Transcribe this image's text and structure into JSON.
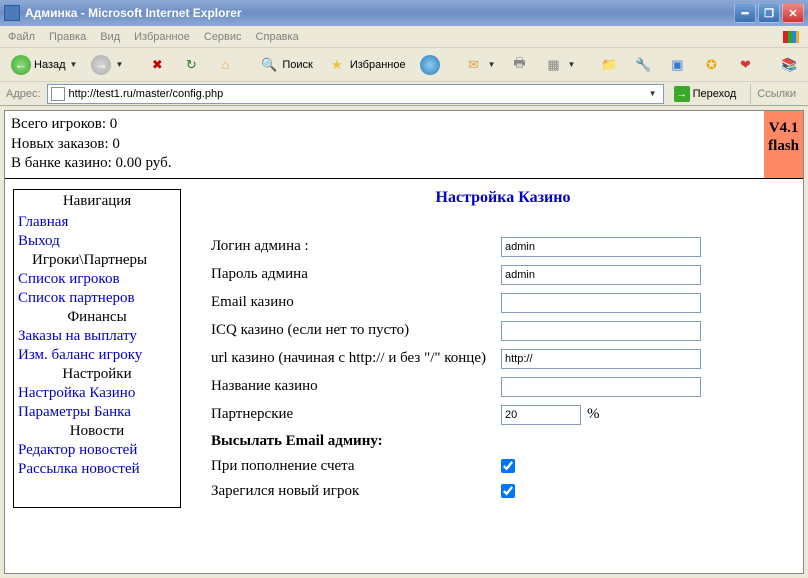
{
  "window": {
    "title": "Админка - Microsoft Internet Explorer"
  },
  "menu": {
    "items": [
      "Файл",
      "Правка",
      "Вид",
      "Избранное",
      "Сервис",
      "Справка"
    ]
  },
  "toolbar": {
    "back_label": "Назад",
    "search_label": "Поиск",
    "favorites_label": "Избранное"
  },
  "addressbar": {
    "label": "Адрес:",
    "url": "http://test1.ru/master/config.php",
    "go_label": "Переход",
    "links_label": "Ссылки"
  },
  "stats": {
    "players": "Всего игроков: 0",
    "new_orders": "Новых заказов: 0",
    "bank": "В банке казино: 0.00 руб.",
    "version_line1": "V4.1",
    "version_line2": "flash"
  },
  "nav": {
    "header": "Навигация",
    "home": "Главная",
    "exit": "Выход",
    "players_partners": "Игроки\\Партнеры",
    "players_list": "Список игроков",
    "partners_list": "Список партнеров",
    "finances": "Финансы",
    "payout_orders": "Заказы на выплату",
    "change_balance": "Изм. баланс игроку",
    "settings": "Настройки",
    "casino_settings": "Настройка Казино",
    "bank_params": "Параметры Банка",
    "news": "Новости",
    "news_editor": "Редактор новостей",
    "news_mail": "Рассылка новостей"
  },
  "form": {
    "title": "Настройка Казино",
    "login_label": "Логин админа :",
    "login_value": "admin",
    "password_label": "Пароль админа",
    "password_value": "admin",
    "email_label": "Email казино",
    "email_value": "",
    "icq_label": "ICQ казино (если нет то пусто)",
    "icq_value": "",
    "url_label": "url казино (начиная с http:// и без \"/\" конце)",
    "url_value": "http://",
    "name_label": "Название казино",
    "name_value": "",
    "partner_label": "Партнерские",
    "partner_value": "20",
    "partner_suffix": "%",
    "send_email_label": "Высылать Email админу:",
    "on_deposit_label": "При пополнение счета",
    "on_register_label": "Зарегился новый игрок"
  }
}
